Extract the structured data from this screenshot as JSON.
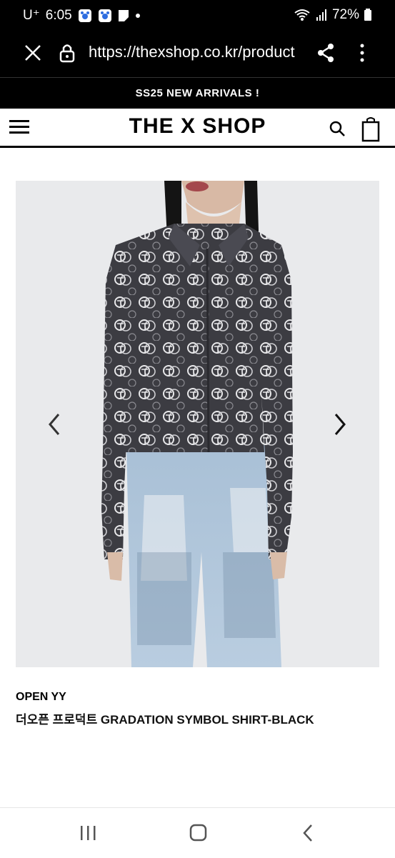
{
  "status_bar": {
    "carrier": "U⁺",
    "time": "6:05",
    "battery": "72%",
    "icons": [
      "baby-monitor-icon",
      "baby-monitor-icon",
      "notes-icon",
      "dot-icon",
      "wifi-icon",
      "signal-icon",
      "battery-icon"
    ]
  },
  "browser": {
    "url": "https://thexshop.co.kr/product",
    "icons": [
      "close-icon",
      "lock-icon",
      "share-icon",
      "more-vert-icon"
    ]
  },
  "banner": {
    "text": "SS25 NEW ARRIVALS !"
  },
  "header": {
    "logo": "THE X SHOP",
    "icons": [
      "menu-icon",
      "search-icon",
      "shopping-bag-icon"
    ]
  },
  "gallery": {
    "icons": [
      "chevron-left-icon",
      "chevron-right-icon"
    ],
    "colors": {
      "background": "#e9eaec",
      "shirt": "#3c3c42",
      "pattern": "#e8e8ea",
      "jeans": "#a9c0d6"
    }
  },
  "product": {
    "brand": "OPEN YY",
    "name": "더오픈 프로덕트 GRADATION SYMBOL SHIRT-BLACK"
  },
  "nav_bar": {
    "icons": [
      "recent-apps-icon",
      "home-icon",
      "back-icon"
    ]
  }
}
